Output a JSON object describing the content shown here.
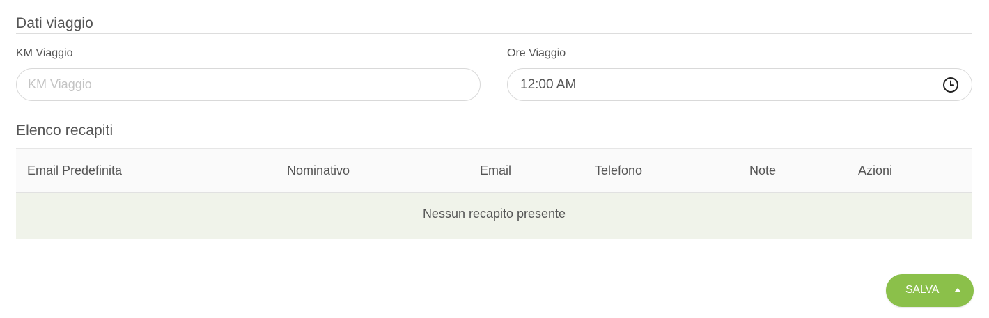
{
  "trip_section": {
    "title": "Dati viaggio",
    "km_label": "KM Viaggio",
    "km_placeholder": "KM Viaggio",
    "km_value": "",
    "hours_label": "Ore Viaggio",
    "hours_value": "12:00 AM",
    "clock_icon": "clock-icon"
  },
  "contacts_section": {
    "title": "Elenco recapiti",
    "columns": [
      "Email Predefinita",
      "Nominativo",
      "Email",
      "Telefono",
      "Note",
      "Azioni"
    ],
    "rows": [],
    "empty_message": "Nessun recapito presente"
  },
  "actions": {
    "save_label": "SALVA",
    "save_caret_icon": "caret-up-icon",
    "accent_color": "#8bc04a"
  }
}
